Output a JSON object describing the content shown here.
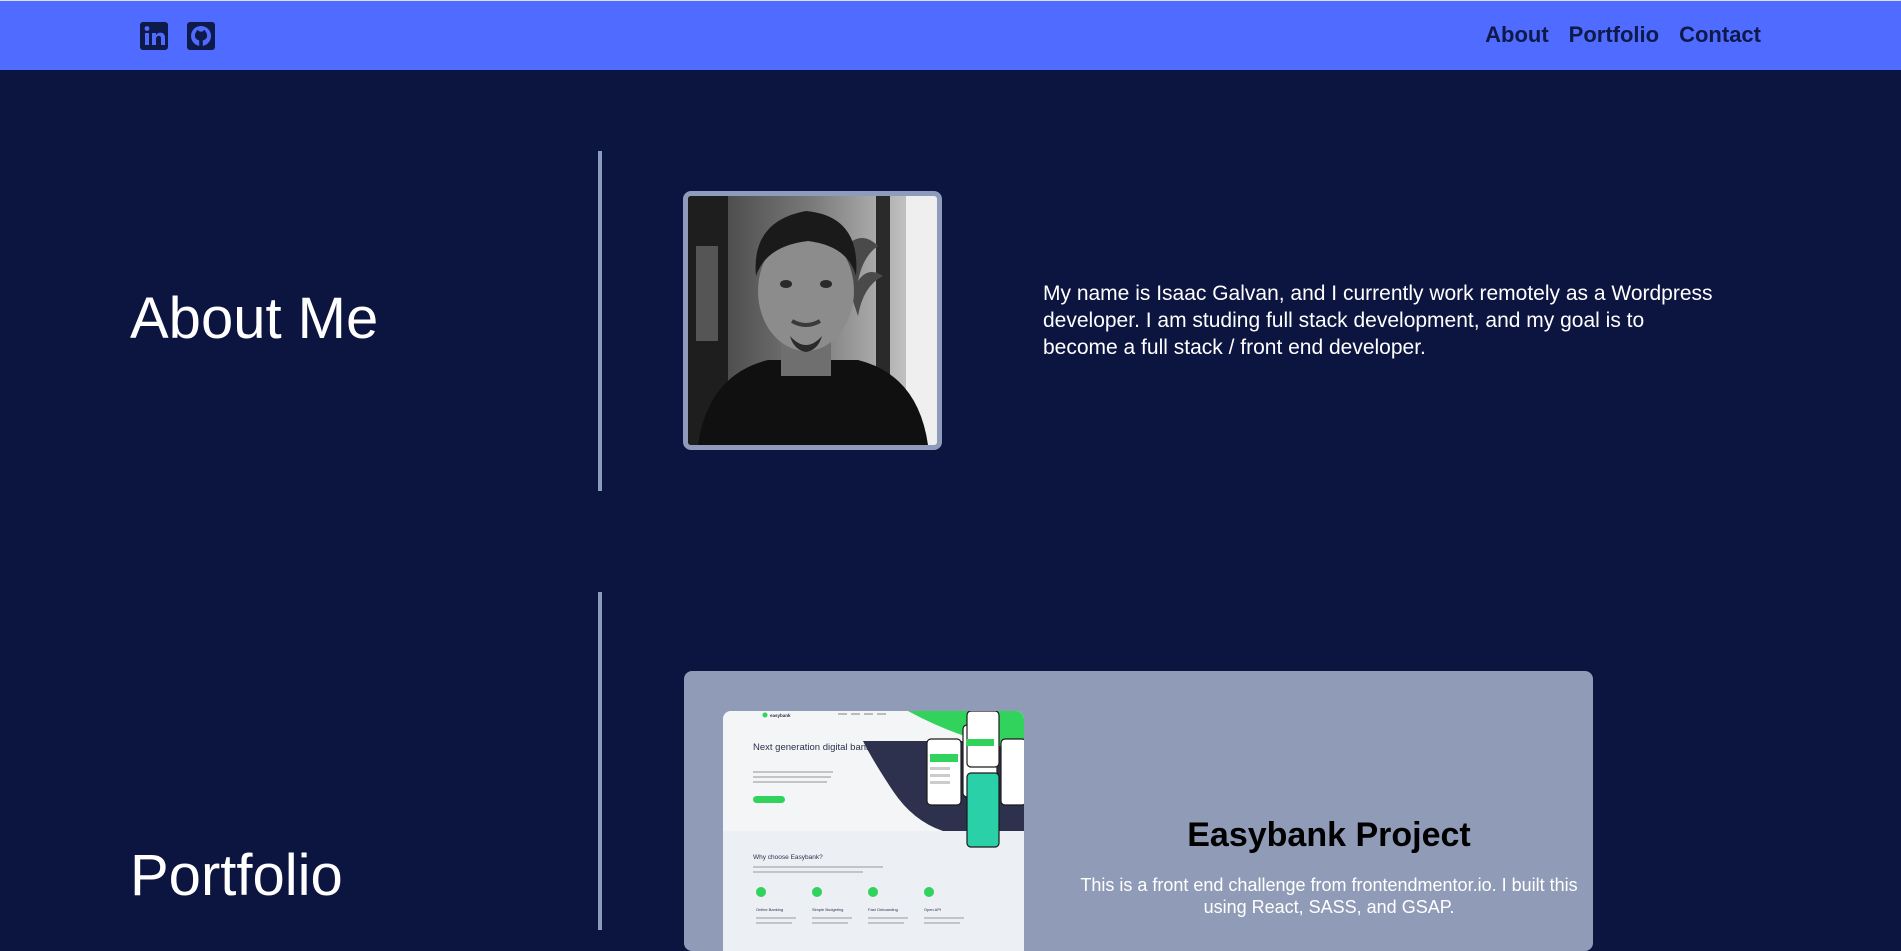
{
  "nav": {
    "links": [
      "About",
      "Portfolio",
      "Contact"
    ],
    "social_icons": [
      "linkedin-icon",
      "github-icon"
    ]
  },
  "about": {
    "title": "About Me",
    "text": "My name is Isaac Galvan, and I currently work remotely as a Wordpress developer. I am studing full stack development, and my goal is to become a full stack / front end developer."
  },
  "portfolio": {
    "title": "Portfolio",
    "projects": [
      {
        "title": "Easybank Project",
        "description": "This is a front end challenge from frontendmentor.io. I built this using React, SASS, and GSAP.",
        "screenshot": {
          "brand": "easybank",
          "headline": "Next generation digital banking",
          "section_heading": "Why choose Easybank?",
          "features": [
            "Online Banking",
            "Simple Budgeting",
            "Fast Onboarding",
            "Open API"
          ]
        }
      }
    ]
  },
  "colors": {
    "nav_bg": "#506bff",
    "page_bg": "#0c1440",
    "card_bg": "#909cb7",
    "accent_green": "#31d35c"
  }
}
